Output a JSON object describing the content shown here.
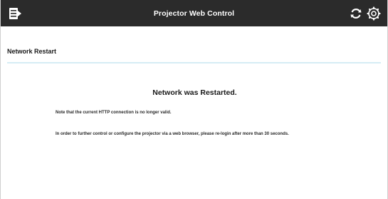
{
  "header": {
    "title": "Projector Web Control",
    "menu_icon": "menu-icon",
    "refresh_icon": "refresh-icon",
    "settings_icon": "settings-icon",
    "bar_color": "#2b2b2b"
  },
  "section": {
    "title": "Network Restart",
    "rule_color": "#d6ecf5"
  },
  "content": {
    "heading": "Network was Restarted.",
    "note_1": "Note that the current HTTP connection is no longer valid.",
    "note_2": "In order to further control or configure the projector via a web browser, please re-login after more than 30 seconds."
  }
}
